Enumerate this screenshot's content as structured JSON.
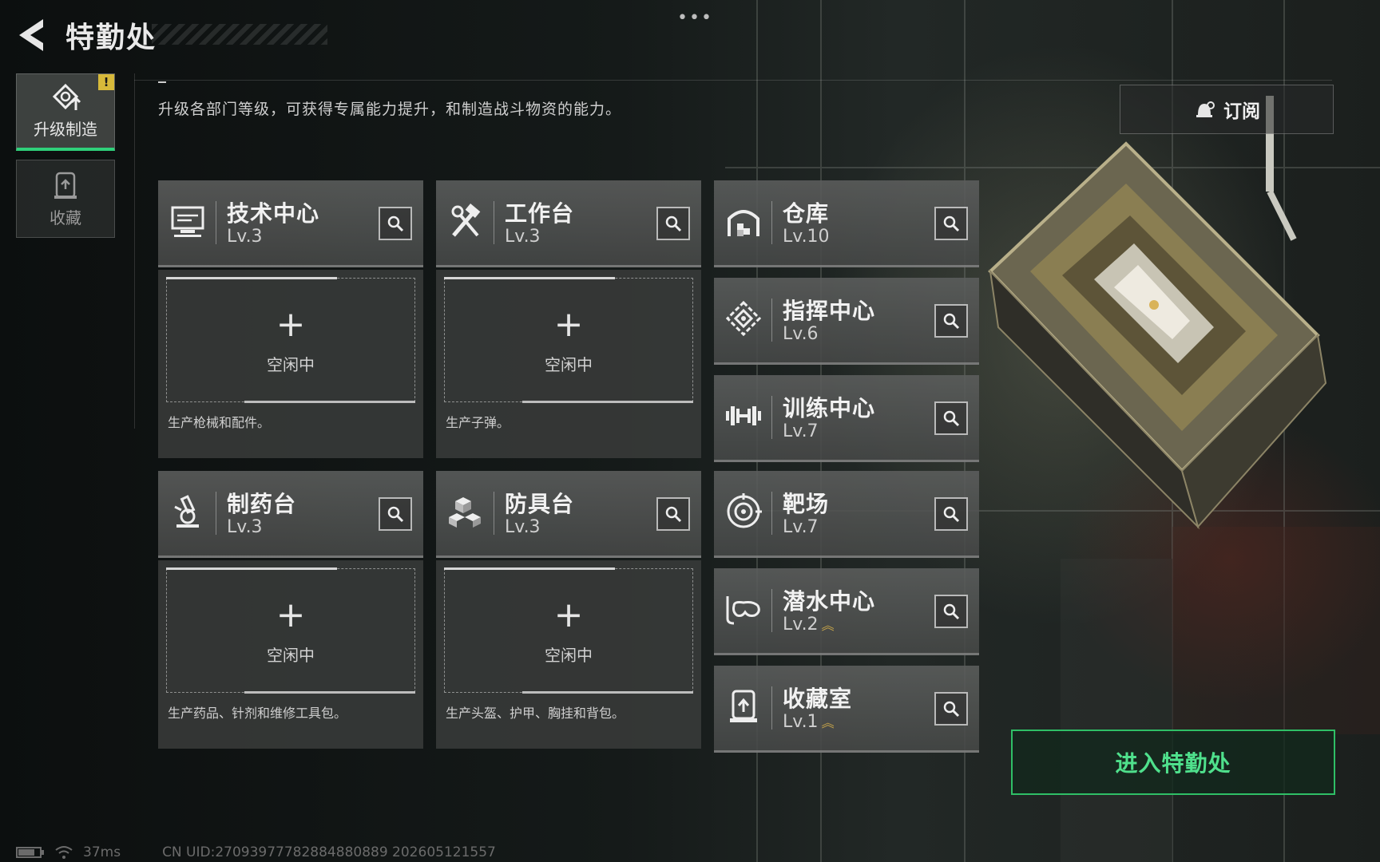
{
  "colors": {
    "accent_green": "#2fd07a",
    "badge_yellow": "#d7b93a",
    "upgrade_gold": "#c9a64a"
  },
  "header": {
    "title": "特勤处",
    "menu_dots": "•••"
  },
  "sidebar": {
    "items": [
      {
        "label": "升级制造",
        "icon": "upgrade-icon",
        "active": true,
        "badge": "!"
      },
      {
        "label": "收藏",
        "icon": "collection-icon",
        "active": false
      }
    ]
  },
  "main": {
    "description": "升级各部门等级，可获得专属能力提升，和制造战斗物资的能力。",
    "subscribe_label": "订阅",
    "production": [
      {
        "name": "技术中心",
        "level": "Lv.3",
        "icon": "computer-icon",
        "slot_status": "空闲中",
        "slot_plus": "+",
        "slot_desc": "生产枪械和配件。"
      },
      {
        "name": "工作台",
        "level": "Lv.3",
        "icon": "tools-icon",
        "slot_status": "空闲中",
        "slot_plus": "+",
        "slot_desc": "生产子弹。"
      },
      {
        "name": "制药台",
        "level": "Lv.3",
        "icon": "microscope-icon",
        "slot_status": "空闲中",
        "slot_plus": "+",
        "slot_desc": "生产药品、针剂和维修工具包。"
      },
      {
        "name": "防具台",
        "level": "Lv.3",
        "icon": "armor-cubes-icon",
        "slot_status": "空闲中",
        "slot_plus": "+",
        "slot_desc": "生产头盔、护甲、胸挂和背包。"
      }
    ],
    "facilities": [
      {
        "name": "仓库",
        "level": "Lv.10",
        "icon": "warehouse-icon",
        "upgradable": false
      },
      {
        "name": "指挥中心",
        "level": "Lv.6",
        "icon": "command-icon",
        "upgradable": false
      },
      {
        "name": "训练中心",
        "level": "Lv.7",
        "icon": "dumbbell-icon",
        "upgradable": false
      },
      {
        "name": "靶场",
        "level": "Lv.7",
        "icon": "target-icon",
        "upgradable": false
      },
      {
        "name": "潜水中心",
        "level": "Lv.2",
        "icon": "diving-mask-icon",
        "upgradable": true
      },
      {
        "name": "收藏室",
        "level": "Lv.1",
        "icon": "collection-room-icon",
        "upgradable": true
      }
    ],
    "enter_label": "进入特勤处"
  },
  "footer": {
    "ping": "37ms",
    "uid": "CN UID:27093977782884880889 202605121557"
  }
}
